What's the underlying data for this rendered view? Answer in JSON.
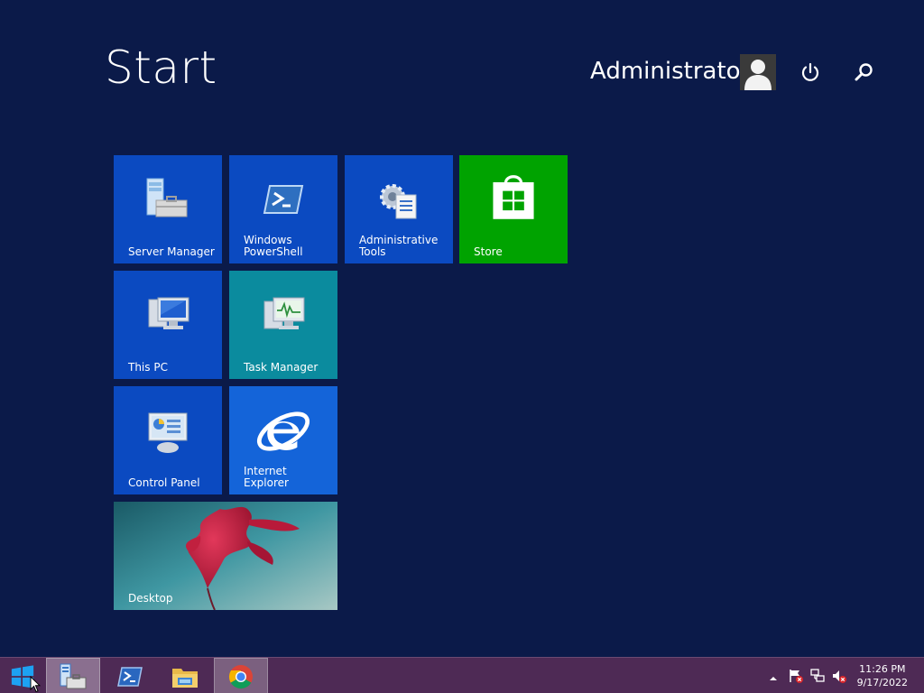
{
  "header": {
    "title": "Start",
    "user_name": "Administrator"
  },
  "tiles": [
    {
      "label": "Server Manager",
      "icon": "server-manager-icon"
    },
    {
      "label": "Windows\nPowerShell",
      "icon": "powershell-icon"
    },
    {
      "label": "Administrative\nTools",
      "icon": "admin-tools-icon"
    },
    {
      "label": "Store",
      "icon": "store-icon"
    },
    {
      "label": "This PC",
      "icon": "this-pc-icon"
    },
    {
      "label": "Task Manager",
      "icon": "task-manager-icon"
    },
    {
      "label": "Control Panel",
      "icon": "control-panel-icon"
    },
    {
      "label": "Internet Explorer",
      "icon": "internet-explorer-icon"
    },
    {
      "label": "Desktop",
      "icon": "desktop-wallpaper"
    }
  ],
  "taskbar": {
    "items": [
      {
        "name": "start",
        "icon": "windows-logo-icon"
      },
      {
        "name": "server-manager",
        "icon": "server-manager-icon"
      },
      {
        "name": "powershell",
        "icon": "powershell-icon"
      },
      {
        "name": "file-explorer",
        "icon": "folder-icon"
      },
      {
        "name": "chrome",
        "icon": "chrome-icon"
      }
    ],
    "clock": {
      "time": "11:26 PM",
      "date": "9/17/2022"
    }
  },
  "colors": {
    "background": "#0b1a49",
    "tile_blue": "#0b4ac1",
    "tile_teal": "#0b8b9e",
    "tile_green": "#00a300",
    "taskbar": "#4e2a55"
  }
}
